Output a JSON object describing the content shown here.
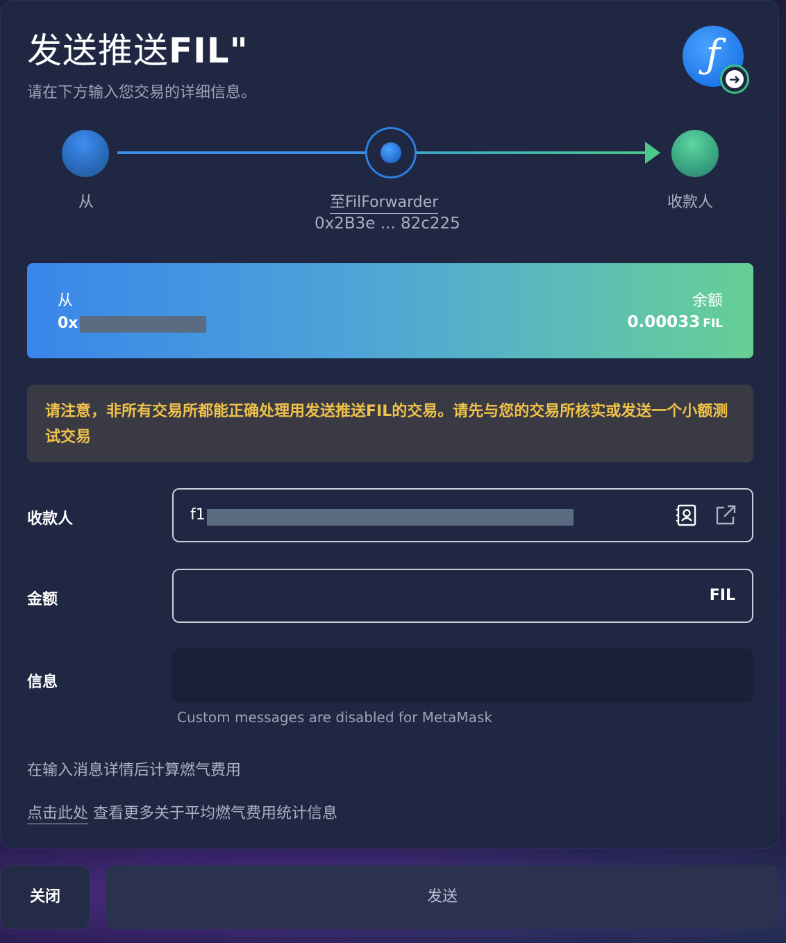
{
  "header": {
    "title_prefix": "发送推送",
    "title_suffix": "FIL\"",
    "subtitle": "请在下方输入您交易的详细信息。"
  },
  "stepper": {
    "from_label": "从",
    "middle_label": "至FilForwarder",
    "middle_address": "0x2B3e ... 82c225",
    "to_label": "收款人"
  },
  "banner": {
    "from_label": "从",
    "from_address": "0x",
    "balance_label": "余额",
    "balance_value": "0.00033",
    "balance_unit": "FIL"
  },
  "warning": {
    "text": "请注意，非所有交易所都能正确处理用发送推送FIL的交易。请先与您的交易所核实或发送一个小额测试交易"
  },
  "form": {
    "recipient_label": "收款人",
    "recipient_value": "f1",
    "amount_label": "金额",
    "amount_unit": "FIL",
    "message_label": "信息",
    "message_note": "Custom messages are disabled for MetaMask",
    "gas_note": "在输入消息详情后计算燃气费用",
    "stats_link": "点击此处",
    "stats_text": "查看更多关于平均燃气费用统计信息"
  },
  "buttons": {
    "close": "关闭",
    "send": "发送"
  },
  "colors": {
    "accent_blue": "#3a86ea",
    "accent_green": "#66cf94",
    "warning_text": "#f0c24a"
  }
}
